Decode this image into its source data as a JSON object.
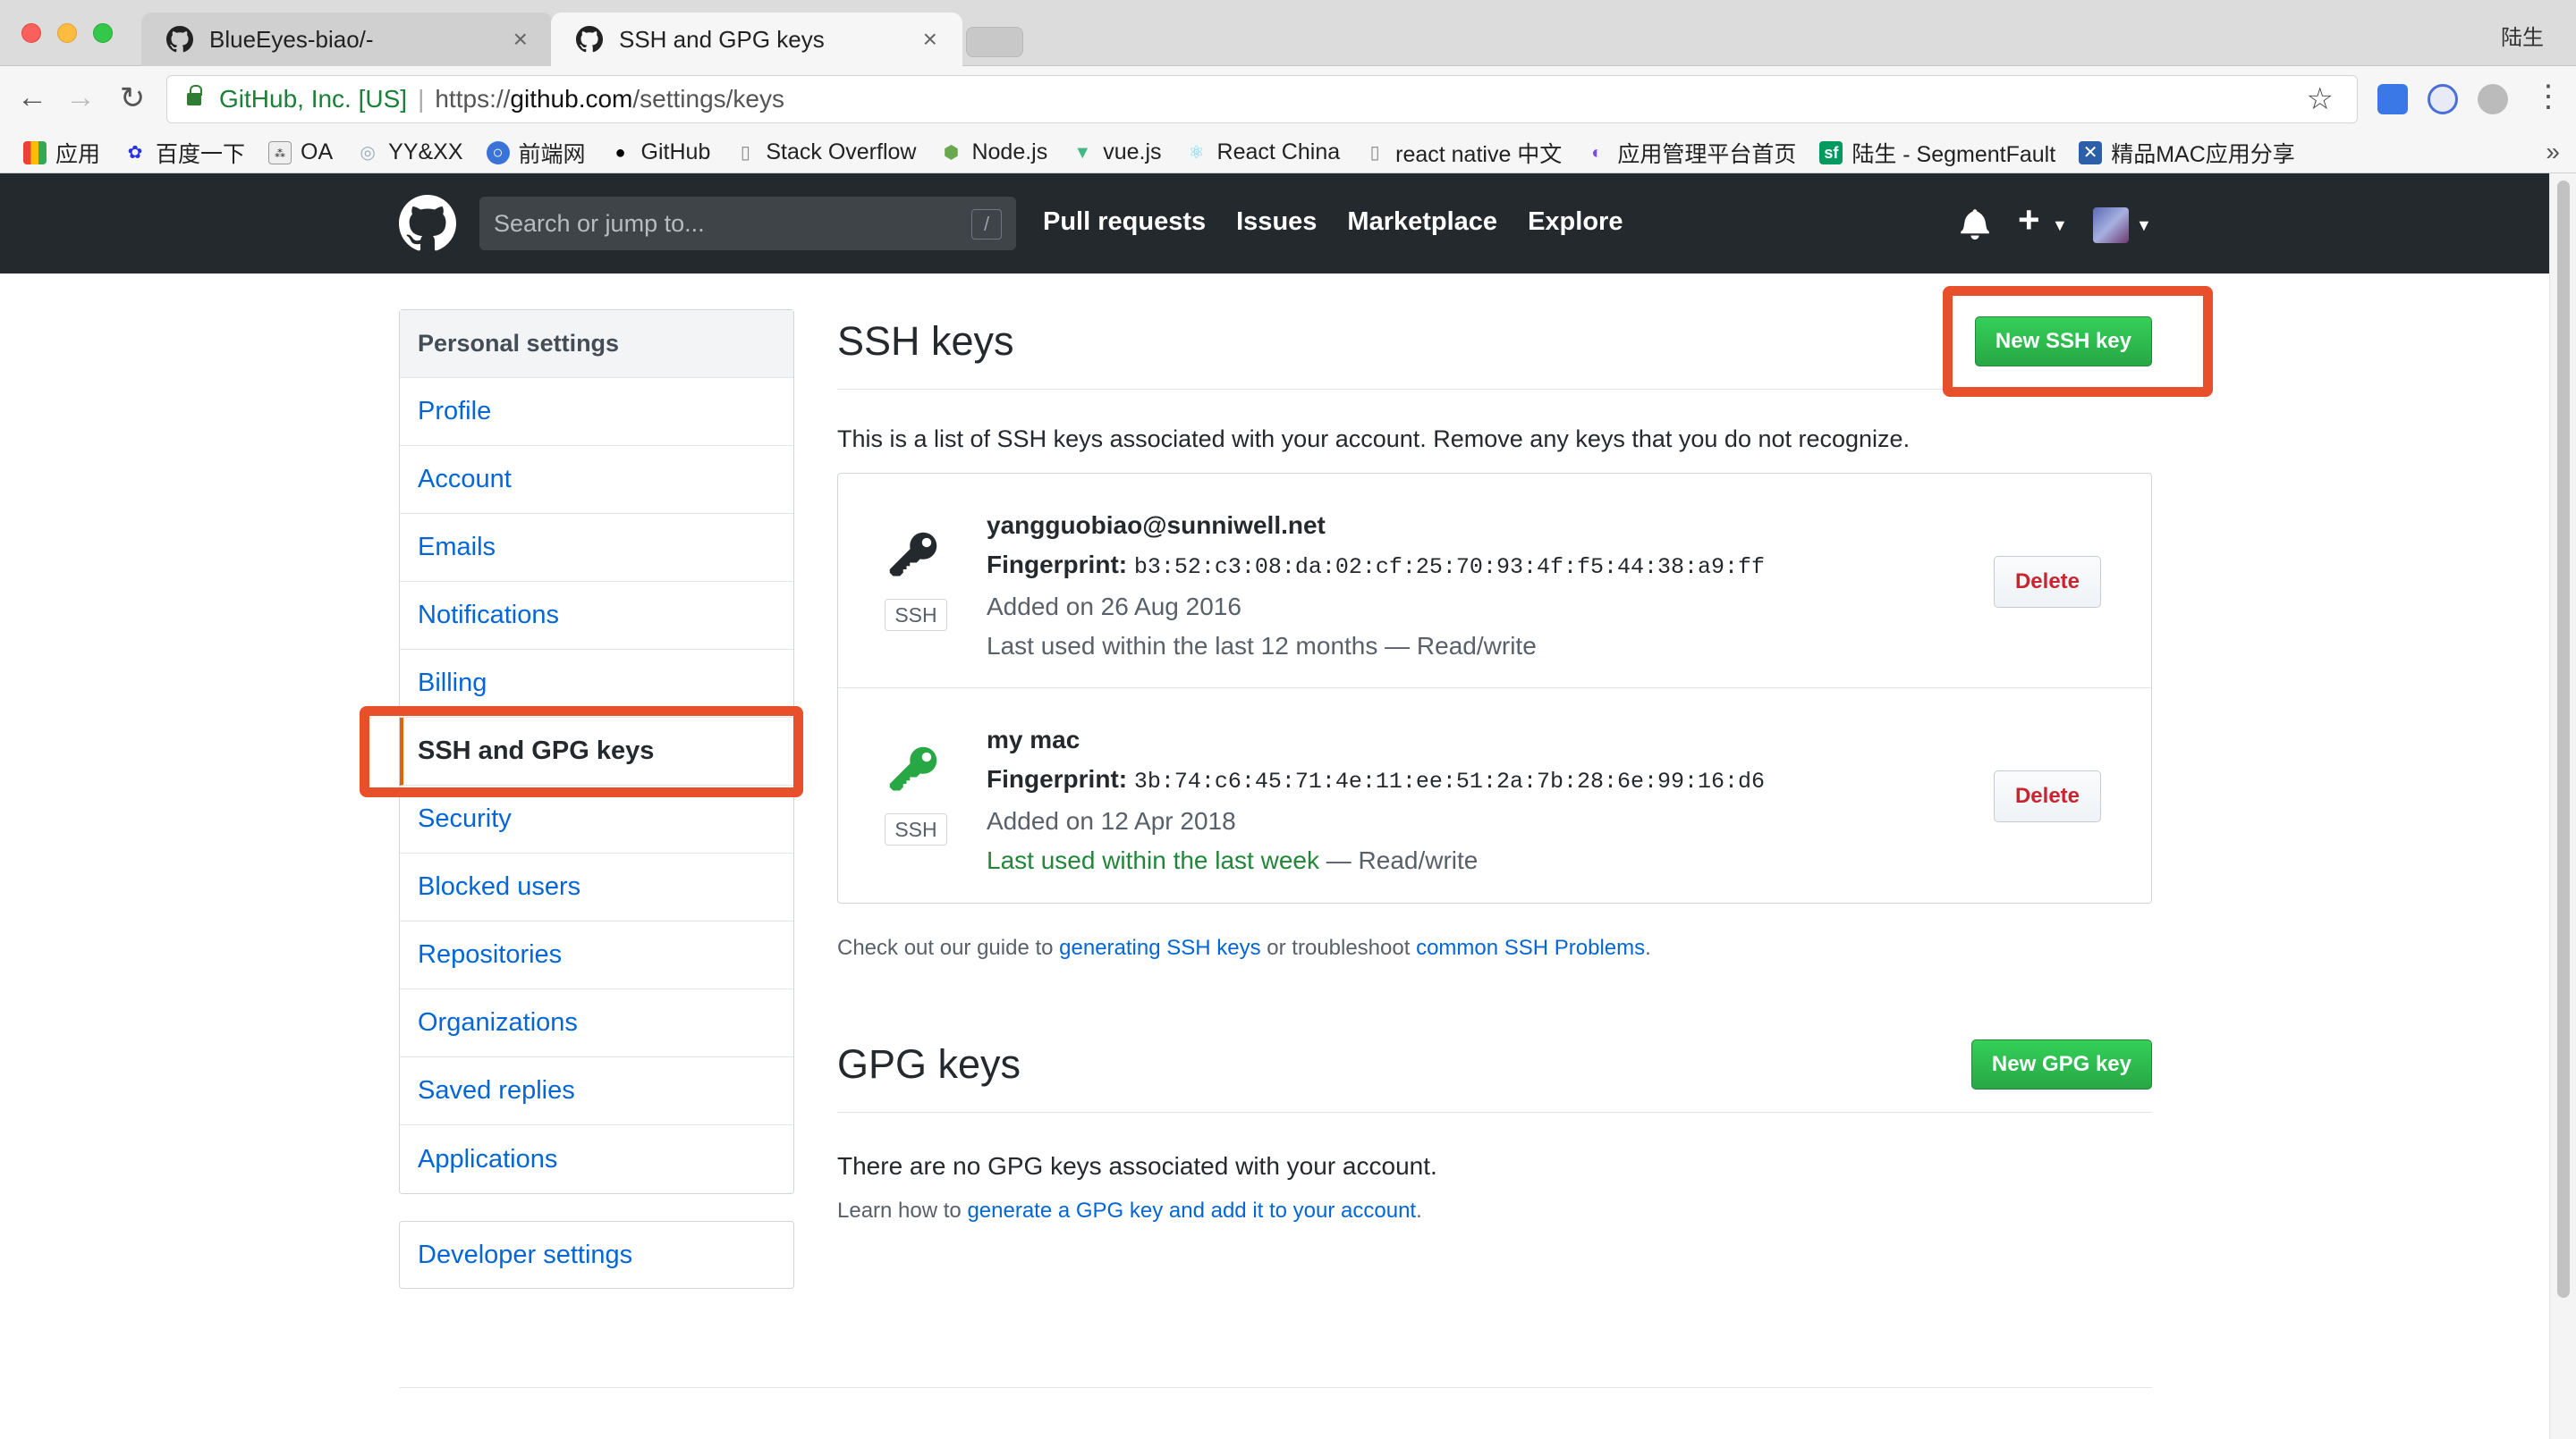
{
  "browser": {
    "tabs": [
      {
        "title": "BlueEyes-biao/-",
        "active": false
      },
      {
        "title": "SSH and GPG keys",
        "active": true
      }
    ],
    "profile_name": "陆生",
    "security_label": "GitHub, Inc. [US]",
    "url_scheme": "https://",
    "url_host": "github.com",
    "url_path": "/settings/keys",
    "bookmarks": [
      "应用",
      "百度一下",
      "OA",
      "YY&XX",
      "前端网",
      "GitHub",
      "Stack Overflow",
      "Node.js",
      "vue.js",
      "React China",
      "react native 中文",
      "应用管理平台首页",
      "陆生 - SegmentFault",
      "精品MAC应用分享"
    ]
  },
  "github_header": {
    "search_placeholder": "Search or jump to...",
    "search_hotkey": "/",
    "nav": [
      "Pull requests",
      "Issues",
      "Marketplace",
      "Explore"
    ]
  },
  "sidebar": {
    "heading": "Personal settings",
    "items": [
      "Profile",
      "Account",
      "Emails",
      "Notifications",
      "Billing",
      "SSH and GPG keys",
      "Security",
      "Blocked users",
      "Repositories",
      "Organizations",
      "Saved replies",
      "Applications"
    ],
    "selected": "SSH and GPG keys",
    "developer_settings": "Developer settings"
  },
  "ssh": {
    "title": "SSH keys",
    "new_button": "New SSH key",
    "intro": "This is a list of SSH keys associated with your account. Remove any keys that you do not recognize.",
    "fingerprint_label": "Fingerprint:",
    "type_label": "SSH",
    "delete_label": "Delete",
    "keys": [
      {
        "title": "yangguobiao@sunniwell.net",
        "fingerprint": "b3:52:c3:08:da:02:cf:25:70:93:4f:f5:44:38:a9:ff",
        "added": "Added on 26 Aug 2016",
        "last_used": "Last used within the last 12 months",
        "access": " — Read/write",
        "icon_color": "#24292e"
      },
      {
        "title": "my mac",
        "fingerprint": "3b:74:c6:45:71:4e:11:ee:51:2a:7b:28:6e:99:16:d6",
        "added": "Added on 12 Apr 2018",
        "last_used": "Last used within the last week",
        "access": " — Read/write",
        "icon_color": "#28a745"
      }
    ],
    "help_prefix": "Check out our guide to ",
    "help_link1": "generating SSH keys",
    "help_middle": " or troubleshoot ",
    "help_link2": "common SSH Problems",
    "help_suffix": "."
  },
  "gpg": {
    "title": "GPG keys",
    "new_button": "New GPG key",
    "empty": "There are no GPG keys associated with your account.",
    "learn_prefix": "Learn how to ",
    "learn_link": "generate a GPG key and add it to your account",
    "learn_suffix": "."
  },
  "colors": {
    "highlight": "#e8502b",
    "link": "#0366d6",
    "primary_button": "#28a745",
    "danger": "#cb2431"
  }
}
